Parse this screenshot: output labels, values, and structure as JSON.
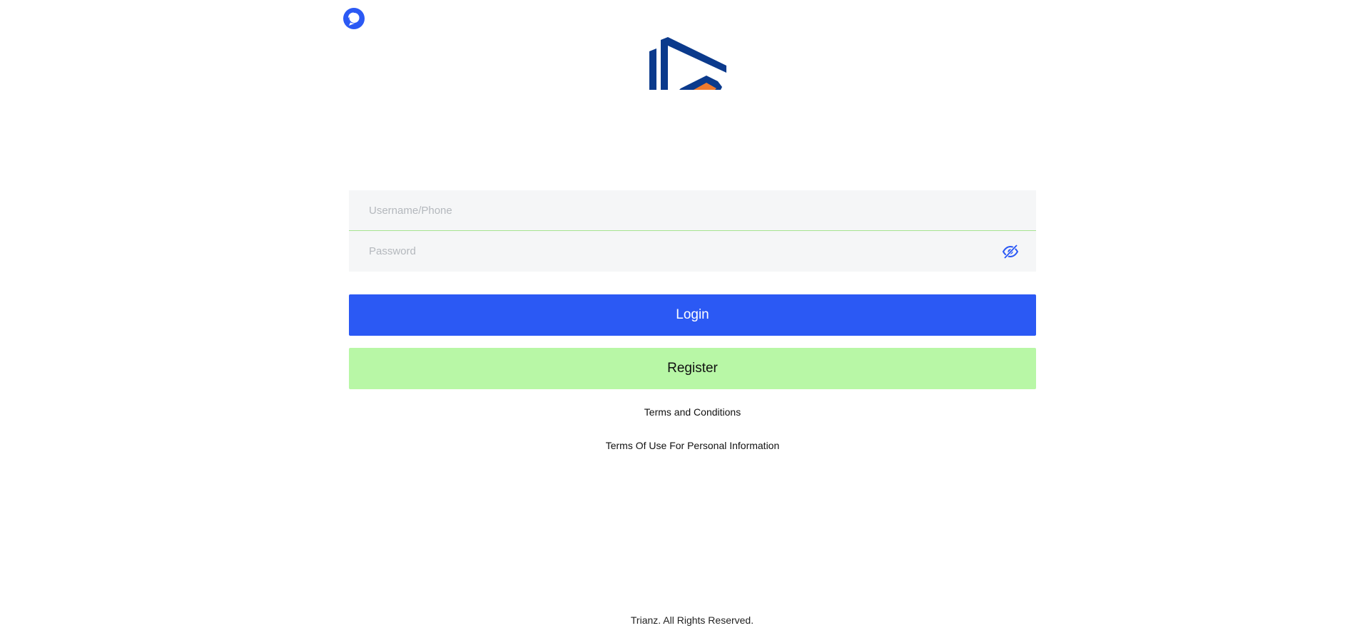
{
  "header": {
    "support_icon": "chat-bubble-icon",
    "logo_icon": "brand-logo-icon"
  },
  "colors": {
    "primary": "#2b59f4",
    "register_bg": "#b8f7a6",
    "logo_blue": "#0b3a8c",
    "logo_orange": "#f07a2d"
  },
  "login_form": {
    "username_placeholder": "Username/Phone",
    "username_value": "",
    "password_placeholder": "Password",
    "password_value": "",
    "password_toggle_icon": "eye-off-icon",
    "login_label": "Login",
    "register_label": "Register"
  },
  "links": {
    "terms": "Terms and Conditions",
    "privacy": "Terms Of Use For Personal Information"
  },
  "footer": {
    "copyright": "Trianz. All Rights Reserved."
  }
}
